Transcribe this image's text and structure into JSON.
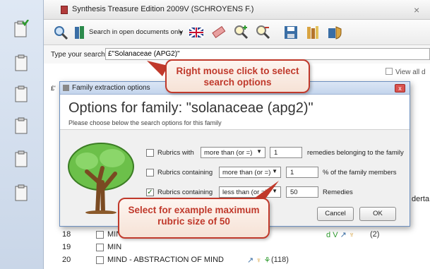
{
  "window": {
    "title": "Synthesis Treasure Edition 2009V (SCHROYENS F.)",
    "close": "×"
  },
  "toolbar": {
    "search_open_label": "Search in open documents only"
  },
  "search": {
    "label": "Type your search:",
    "value": "£\"Solanaceae (APG2)\""
  },
  "results": {
    "view_all_label": "View all d",
    "row_prefix": "£'",
    "rows": [
      {
        "num": "18",
        "text": "MIN"
      },
      {
        "num": "19",
        "text": "MIN"
      },
      {
        "num": "20",
        "text": "MIND - ABSTRACTION OF MIND",
        "count": "(118)"
      }
    ],
    "row18_tail": "(2)",
    "side_text": "derta"
  },
  "dialog": {
    "title": "Family extraction options",
    "close": "x",
    "heading": "Options for family: \"solanaceae (apg2)\"",
    "subheading": "Please choose below the search options for this family",
    "options": [
      {
        "checked": false,
        "label": "Rubrics with",
        "operator": "more than (or =)",
        "value": "1",
        "suffix": "remedies belonging to the family"
      },
      {
        "checked": false,
        "label": "Rubrics containing",
        "operator": "more than (or =)",
        "value": "1",
        "suffix": "% of the family members"
      },
      {
        "checked": true,
        "label": "Rubrics containing",
        "operator": "less than (or =)",
        "value": "50",
        "suffix": "Remedies"
      }
    ],
    "cancel_label": "Cancel",
    "ok_label": "OK"
  },
  "callouts": {
    "top": "Right mouse click to select search options",
    "bottom": "Select for example maximum rubric size of 50"
  },
  "colors": {
    "callout_border": "#c0392b",
    "callout_text": "#c0392b",
    "tree_green": "#5cb85c"
  }
}
